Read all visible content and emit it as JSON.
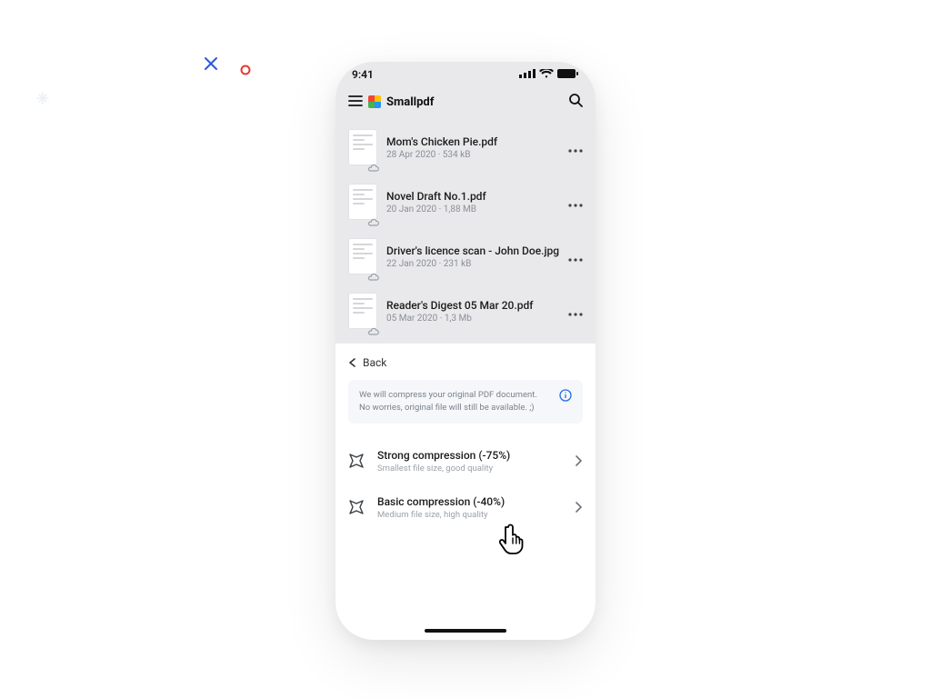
{
  "statusbar": {
    "time": "9:41"
  },
  "appbar": {
    "brand": "Smallpdf"
  },
  "files": [
    {
      "title": "Mom's Chicken Pie.pdf",
      "sub": "28 Apr 2020 · 534 kB"
    },
    {
      "title": "Novel Draft No.1.pdf",
      "sub": "20 Jan 2020 · 1,88 MB"
    },
    {
      "title": "Driver's licence scan - John Doe.jpg",
      "sub": "22 Jan 2020 · 231 kB"
    },
    {
      "title": "Reader's Digest 05 Mar 20.pdf",
      "sub": "05 Mar 2020 · 1,3 Mb"
    }
  ],
  "sheet": {
    "back_label": "Back",
    "info_line1": "We will compress your original PDF document.",
    "info_line2": "No worries, original file will still be available. ;)",
    "options": [
      {
        "title": "Strong compression (-75%)",
        "sub": "Smallest file size, good quality"
      },
      {
        "title": "Basic compression (-40%)",
        "sub": "Medium file size, high quality"
      }
    ]
  }
}
